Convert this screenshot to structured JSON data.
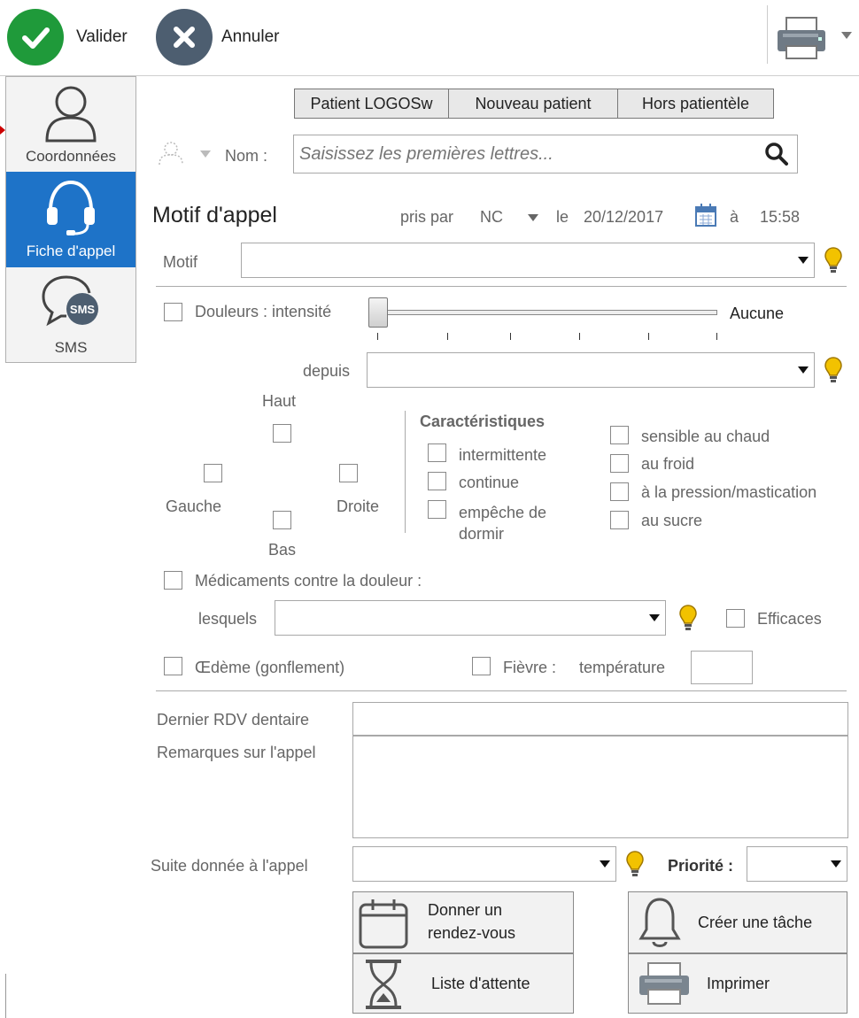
{
  "toolbar": {
    "validate_label": "Valider",
    "cancel_label": "Annuler"
  },
  "sidebar": {
    "items": [
      {
        "label": "Coordonnées"
      },
      {
        "label": "Fiche d'appel"
      },
      {
        "label": "SMS"
      }
    ],
    "sms_badge": "SMS"
  },
  "patient_tabs": [
    "Patient LOGOSw",
    "Nouveau patient",
    "Hors patientèle"
  ],
  "search": {
    "name_label": "Nom :",
    "placeholder": "Saisissez les premières lettres..."
  },
  "motif": {
    "title": "Motif d'appel",
    "taken_by_label": "pris par",
    "taken_by_value": "NC",
    "date_prefix": "le",
    "date": "20/12/2017",
    "time_prefix": "à",
    "time": "15:58",
    "motif_label": "Motif"
  },
  "douleur": {
    "label": "Douleurs : intensité",
    "intensity_value": "Aucune",
    "since_label": "depuis",
    "location": {
      "top": "Haut",
      "left": "Gauche",
      "right": "Droite",
      "bottom": "Bas"
    },
    "characteristics_title": "Caractéristiques",
    "characteristics": [
      "intermittente",
      "continue",
      "empêche de dormir"
    ],
    "sensitivity": [
      "sensible au chaud",
      "au froid",
      "à la pression/mastication",
      "au sucre"
    ]
  },
  "medication": {
    "label": "Médicaments contre la douleur :",
    "which_label": "lesquels",
    "effective_label": "Efficaces"
  },
  "oedeme_label": "Œdème (gonflement)",
  "fievre": {
    "label": "Fièvre :",
    "temp_label": "température"
  },
  "last_appointment_label": "Dernier RDV dentaire",
  "remarks_label": "Remarques sur l'appel",
  "followup_label": "Suite donnée à l'appel",
  "priority_label": "Priorité :",
  "actions": {
    "appointment_line1": "Donner un",
    "appointment_line2": "rendez-vous",
    "waiting_list": "Liste d'attente",
    "create_task": "Créer une tâche",
    "print": "Imprimer"
  },
  "colors": {
    "validate": "#1f9a3a",
    "cancel": "#4d5e70",
    "active_tab": "#1e73c8",
    "bulb": "#f2c200"
  }
}
